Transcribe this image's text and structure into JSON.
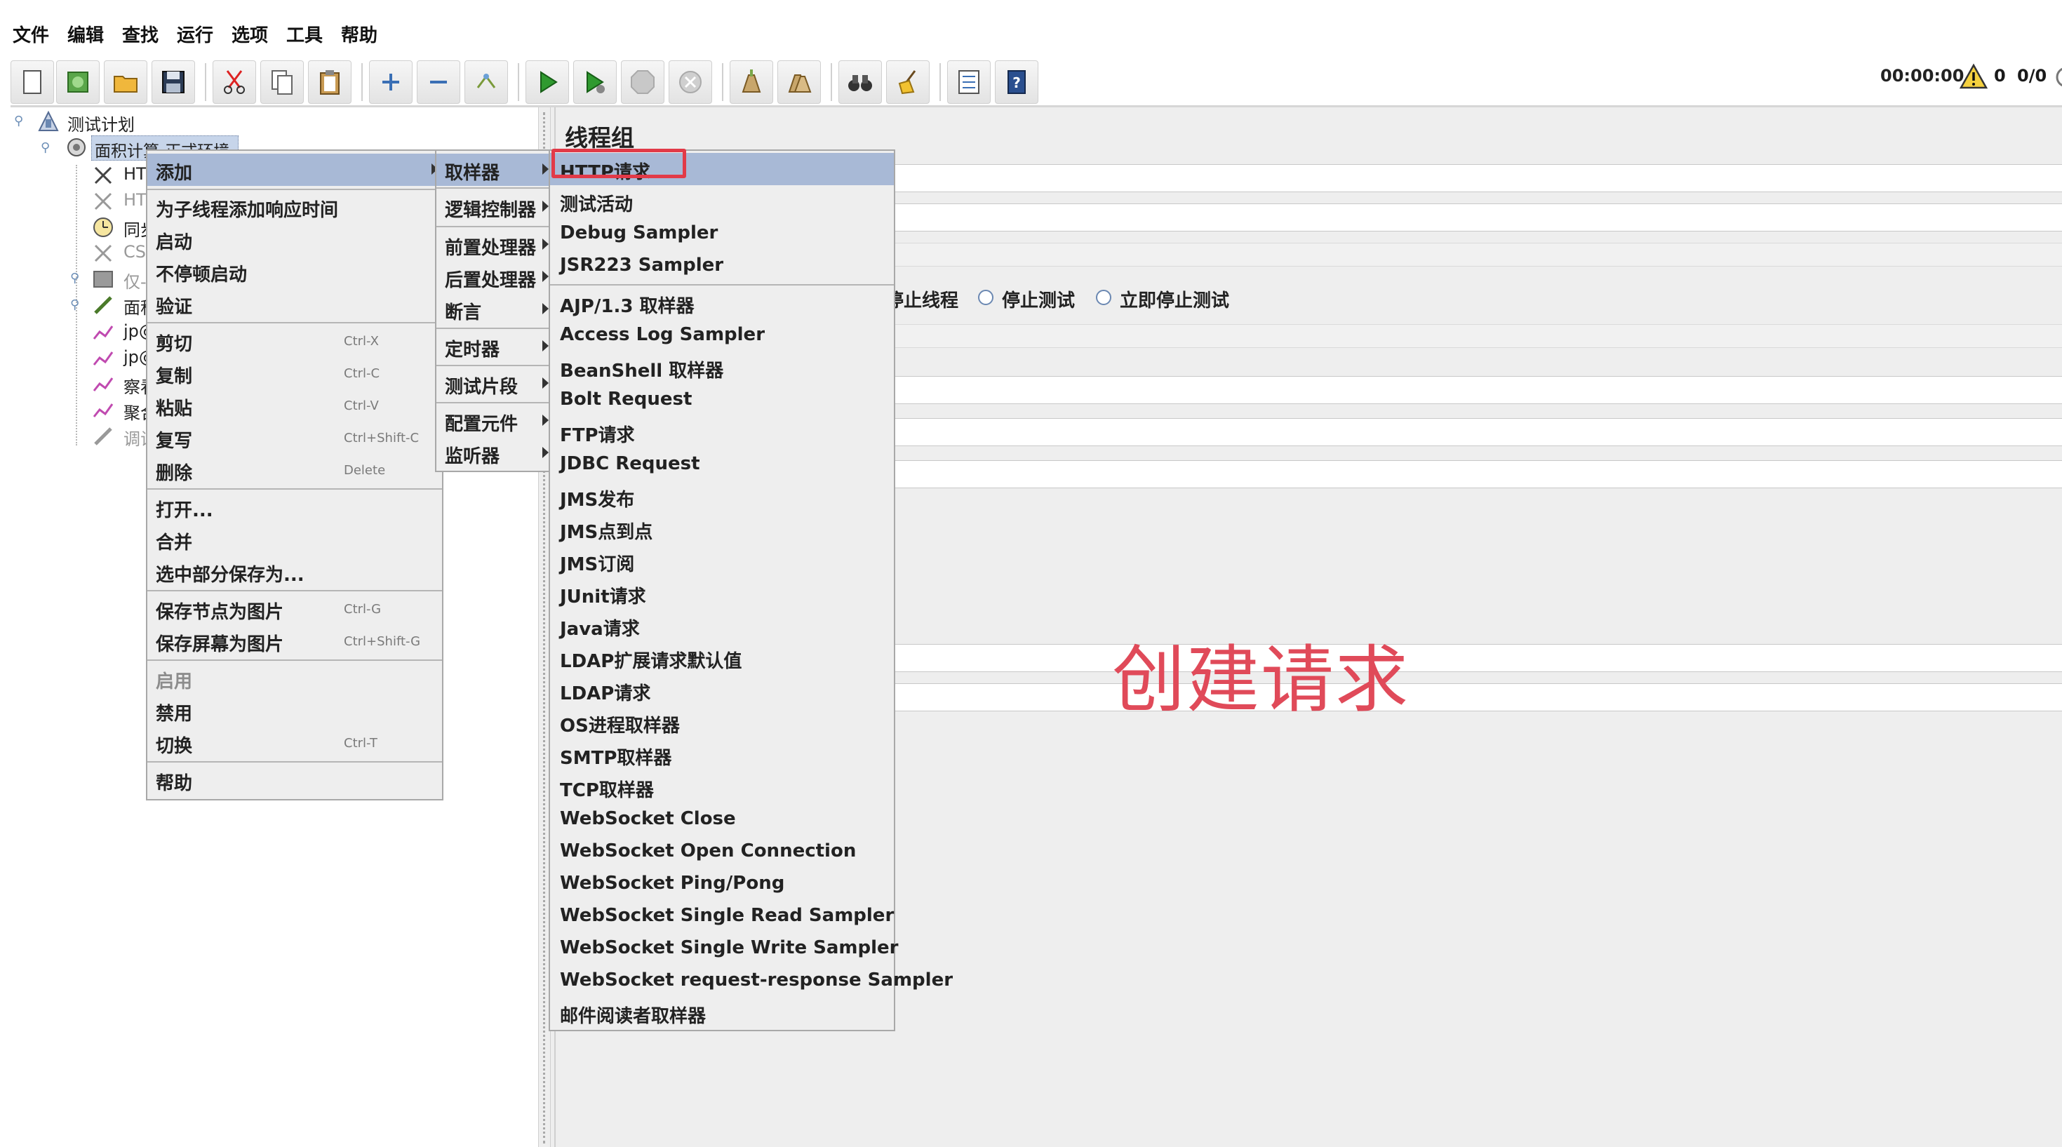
{
  "menubar": [
    "文件",
    "编辑",
    "查找",
    "运行",
    "选项",
    "工具",
    "帮助"
  ],
  "toolbar": {
    "buttons": [
      "new-file-icon",
      "templates-icon",
      "open-folder-icon",
      "save-icon",
      "cut-icon",
      "copy-icon",
      "paste-icon",
      "expand-plus-icon",
      "collapse-minus-icon",
      "toggle-icon",
      "start-icon",
      "start-no-pause-icon",
      "stop-icon",
      "shutdown-icon",
      "clear-icon",
      "clear-all-icon",
      "search-binoculars-icon",
      "reset-search-broom-icon",
      "function-helper-icon",
      "help-icon"
    ],
    "timer": "00:00:00",
    "warnings": "0",
    "threads": "0/0"
  },
  "tree": {
    "root": "测试计划",
    "selected": "面积计算-正式环境",
    "children": [
      "HT",
      "HT",
      "同步",
      "CS",
      "仅-",
      "面积",
      "jp@",
      "jp@",
      "察看",
      "聚合",
      "调试"
    ]
  },
  "panel": {
    "title": "线程组",
    "radio_options": [
      "停止线程",
      "停止测试",
      "立即停止测试"
    ]
  },
  "annotation": "创建请求",
  "context_menu": {
    "items": [
      {
        "label": "添加",
        "submenu": true
      },
      {
        "label": "为子线程添加响应时间"
      },
      {
        "label": "启动"
      },
      {
        "label": "不停顿启动"
      },
      {
        "label": "验证"
      },
      {
        "label": "剪切",
        "accel": "Ctrl-X"
      },
      {
        "label": "复制",
        "accel": "Ctrl-C"
      },
      {
        "label": "粘贴",
        "accel": "Ctrl-V"
      },
      {
        "label": "复写",
        "accel": "Ctrl+Shift-C"
      },
      {
        "label": "删除",
        "accel": "Delete"
      },
      {
        "label": "打开..."
      },
      {
        "label": "合并"
      },
      {
        "label": "选中部分保存为..."
      },
      {
        "label": "保存节点为图片",
        "accel": "Ctrl-G"
      },
      {
        "label": "保存屏幕为图片",
        "accel": "Ctrl+Shift-G"
      },
      {
        "label": "启用"
      },
      {
        "label": "禁用"
      },
      {
        "label": "切换",
        "accel": "Ctrl-T"
      },
      {
        "label": "帮助"
      }
    ]
  },
  "add_menu": [
    "取样器",
    "逻辑控制器",
    "前置处理器",
    "后置处理器",
    "断言",
    "定时器",
    "测试片段",
    "配置元件",
    "监听器"
  ],
  "sampler_menu": [
    "HTTP请求",
    "测试活动",
    "Debug Sampler",
    "JSR223 Sampler",
    "AJP/1.3 取样器",
    "Access Log Sampler",
    "BeanShell 取样器",
    "Bolt Request",
    "FTP请求",
    "JDBC Request",
    "JMS发布",
    "JMS点到点",
    "JMS订阅",
    "JUnit请求",
    "Java请求",
    "LDAP扩展请求默认值",
    "LDAP请求",
    "OS进程取样器",
    "SMTP取样器",
    "TCP取样器",
    "WebSocket Close",
    "WebSocket Open Connection",
    "WebSocket Ping/Pong",
    "WebSocket Single Read Sampler",
    "WebSocket Single Write Sampler",
    "WebSocket request-response Sampler",
    "邮件阅读者取样器"
  ],
  "colors": {
    "highlight": "#a8b9d6",
    "annotation": "#e04a59",
    "callout_box": "#e23a48"
  }
}
